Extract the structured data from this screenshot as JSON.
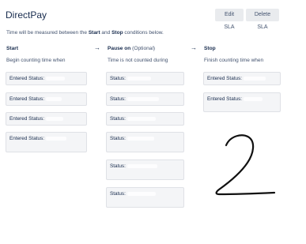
{
  "header": {
    "title": "DirectPay",
    "edit_label": "Edit SLA",
    "delete_label": "Delete SLA"
  },
  "description": {
    "prefix": "Time will be measured between the ",
    "start": "Start",
    "middle": " and ",
    "stop": "Stop",
    "suffix": " conditions below."
  },
  "columns": {
    "start": {
      "title": "Start",
      "subtitle": "Begin counting time when",
      "items": [
        "Entered Status:",
        "Entered Status:",
        "Entered Status:",
        "Entered Status:"
      ]
    },
    "pause": {
      "title": "Pause on",
      "optional": "(Optional)",
      "subtitle": "Time is not counted during",
      "items": [
        "Status:",
        "Status:",
        "Status:",
        "Status:",
        "Status:",
        "Status:"
      ]
    },
    "stop": {
      "title": "Stop",
      "subtitle": "Finish counting time when",
      "items": [
        "Entered Status:",
        "Entered Status:"
      ]
    }
  },
  "arrows": [
    "→",
    "→"
  ],
  "handwritten_mark": "2"
}
